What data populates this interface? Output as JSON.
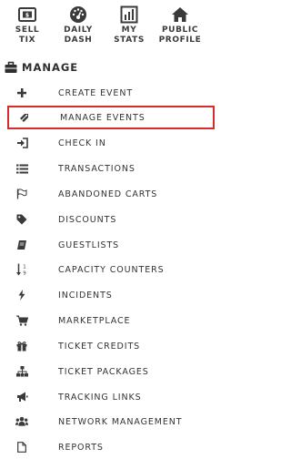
{
  "topnav": {
    "items": [
      {
        "label": "SELL\nTIX",
        "icon": "ticket-icon"
      },
      {
        "label": "DAILY\nDASH",
        "icon": "dashboard-gauge-icon"
      },
      {
        "label": "MY\nSTATS",
        "icon": "bar-chart-icon"
      },
      {
        "label": "PUBLIC\nPROFILE",
        "icon": "home-icon"
      }
    ]
  },
  "section": {
    "title": "MANAGE",
    "icon": "briefcase-icon"
  },
  "menu": {
    "items": [
      {
        "label": "CREATE EVENT",
        "icon": "plus-icon"
      },
      {
        "label": "MANAGE EVENTS",
        "icon": "tag-pencil-icon",
        "highlighted": true
      },
      {
        "label": "CHECK IN",
        "icon": "sign-in-icon"
      },
      {
        "label": "TRANSACTIONS",
        "icon": "list-icon"
      },
      {
        "label": "ABANDONED CARTS",
        "icon": "flag-icon"
      },
      {
        "label": "DISCOUNTS",
        "icon": "tag-icon"
      },
      {
        "label": "GUESTLISTS",
        "icon": "book-icon"
      },
      {
        "label": "CAPACITY COUNTERS",
        "icon": "sort-numeric-icon"
      },
      {
        "label": "INCIDENTS",
        "icon": "bolt-icon"
      },
      {
        "label": "MARKETPLACE",
        "icon": "cart-icon"
      },
      {
        "label": "TICKET CREDITS",
        "icon": "gift-icon"
      },
      {
        "label": "TICKET PACKAGES",
        "icon": "sitemap-icon"
      },
      {
        "label": "TRACKING LINKS",
        "icon": "bullhorn-icon"
      },
      {
        "label": "NETWORK MANAGEMENT",
        "icon": "users-icon"
      },
      {
        "label": "REPORTS",
        "icon": "file-icon"
      }
    ]
  },
  "colors": {
    "highlight_border": "#d62b2b",
    "text": "#333333",
    "icon": "#3a3a3a"
  }
}
